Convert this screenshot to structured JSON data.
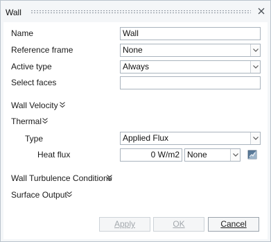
{
  "window": {
    "title": "Wall"
  },
  "form": {
    "name_label": "Name",
    "name_value": "Wall",
    "reference_frame_label": "Reference frame",
    "reference_frame_value": "None",
    "active_type_label": "Active type",
    "active_type_value": "Always",
    "select_faces_label": "Select faces",
    "select_faces_value": ""
  },
  "sections": {
    "wall_velocity": "Wall Velocity",
    "thermal": "Thermal",
    "wall_turbulence": "Wall Turbulence Conditions",
    "surface_output": "Surface Output"
  },
  "thermal": {
    "type_label": "Type",
    "type_value": "Applied Flux",
    "heat_flux_label": "Heat flux",
    "heat_flux_value": "0 W/m2",
    "heat_flux_option": "None"
  },
  "buttons": {
    "apply": "Apply",
    "ok": "OK",
    "cancel": "Cancel"
  },
  "colors": {
    "border": "#a9b3bd",
    "panel": "#ffffff",
    "frame": "#f4f6f8",
    "disabled_text": "#a3a8ad"
  }
}
